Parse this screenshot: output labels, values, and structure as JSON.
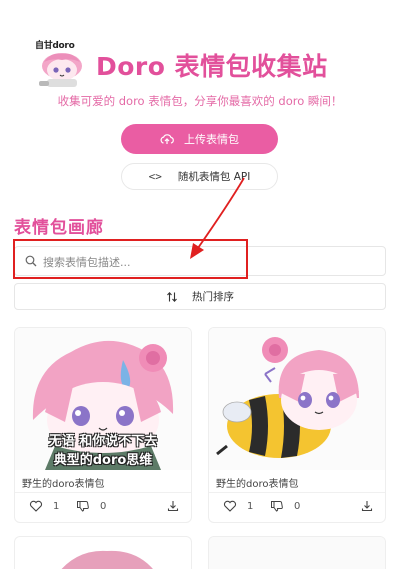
{
  "header": {
    "logo_text": "自甘doro",
    "title": "Doro 表情包收集站"
  },
  "subtitle": "收集可爱的 doro 表情包，分享你最喜欢的 doro 瞬间！",
  "actions": {
    "upload_label": "上传表情包",
    "api_label": "随机表情包 API",
    "api_icon": "<>"
  },
  "gallery": {
    "title": "表情包画廊",
    "search_placeholder": "搜索表情包描述...",
    "sort_label": "热门排序"
  },
  "cards": [
    {
      "caption_line1": "无语 和你说不下去",
      "caption_line2": "典型的doro思维",
      "description": "野生的doro表情包",
      "likes": "1",
      "dislikes": "0"
    },
    {
      "description": "野生的doro表情包",
      "likes": "1",
      "dislikes": "0"
    }
  ],
  "colors": {
    "brand_pink": "#e2509b",
    "button_pink": "#ea5da3",
    "annotation_red": "#e02020"
  }
}
